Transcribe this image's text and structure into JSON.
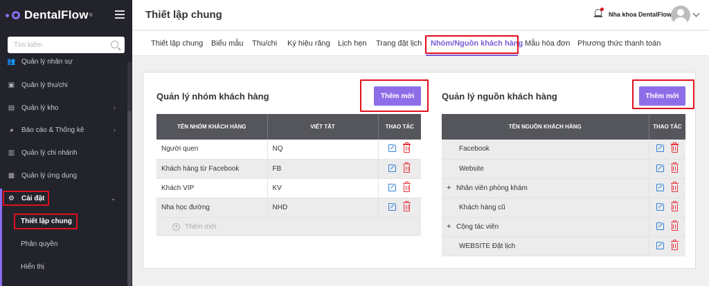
{
  "brand": {
    "name": "DentalFlow",
    "reg": "®"
  },
  "sidebar": {
    "search_placeholder": "Tìm kiếm",
    "items": [
      {
        "label": "Quản lý nhân sự",
        "icon": "users-icon"
      },
      {
        "label": "Quản lý thu/chi",
        "icon": "cash-icon"
      },
      {
        "label": "Quản lý kho",
        "icon": "warehouse-icon",
        "chevron": "›"
      },
      {
        "label": "Báo cáo & Thống kê",
        "icon": "pie-chart-icon",
        "chevron": "›"
      },
      {
        "label": "Quản lý chi nhánh",
        "icon": "branch-icon"
      },
      {
        "label": "Quản lý ứng dụng",
        "icon": "apps-icon"
      },
      {
        "label": "Cài đặt",
        "icon": "gear-icon",
        "chevron": "⌄"
      }
    ],
    "sub_items": [
      "Thiết lập chung",
      "Phân quyền",
      "Hiển thị"
    ]
  },
  "header": {
    "title": "Thiết lập chung",
    "clinic_name": "Nha khoa DentalFlow"
  },
  "tabs": [
    "Thiết lập chung",
    "Biểu mẫu",
    "Thu/chi",
    "Ký hiệu răng",
    "Lịch hẹn",
    "Trang đặt lịch",
    "Nhóm/Nguồn khách hàng",
    "Mẫu hóa đơn",
    "Phương thức thanh toán"
  ],
  "groups": {
    "title": "Quản lý nhóm khách hàng",
    "add_label": "Thêm mới",
    "columns": [
      "Tên nhóm khách hàng",
      "Viết tắt",
      "Thao tác"
    ],
    "rows": [
      {
        "name": "Người quen",
        "abbr": "NQ"
      },
      {
        "name": "Khách hàng từ Facebook",
        "abbr": "FB"
      },
      {
        "name": "Khách VIP",
        "abbr": "KV"
      },
      {
        "name": "Nha học đường",
        "abbr": "NHD"
      }
    ],
    "add_row_label": "Thêm mới"
  },
  "sources": {
    "title": "Quản lý nguồn khách hàng",
    "add_label": "Thêm mới",
    "columns": [
      "Tên nguồn khách hàng",
      "Thao tác"
    ],
    "rows": [
      {
        "name": "Facebook",
        "expand": ""
      },
      {
        "name": "Website",
        "expand": ""
      },
      {
        "name": "Nhân viên phòng khám",
        "expand": "+"
      },
      {
        "name": "Khách hàng cũ",
        "expand": ""
      },
      {
        "name": "Cộng tác viên",
        "expand": "+"
      },
      {
        "name": "WEBSITE Đặt lịch",
        "expand": ""
      }
    ]
  },
  "colors": {
    "accent": "#8e6ee8",
    "sidebar_bg": "#22232b",
    "highlight": "#e0101c",
    "edit": "#2f7fd8",
    "delete": "#e8323c"
  }
}
